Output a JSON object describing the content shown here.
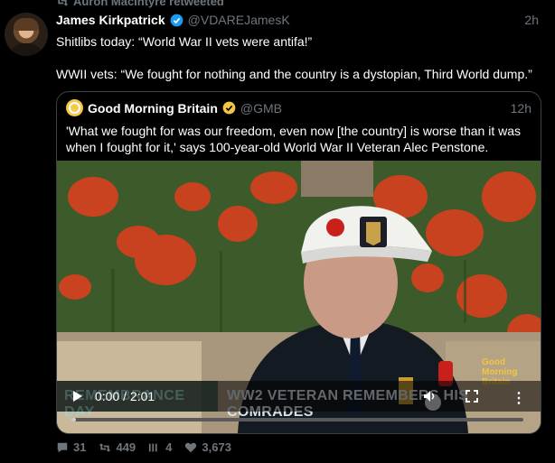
{
  "retweet": {
    "text": "Auron MacIntyre retweeted"
  },
  "tweet": {
    "author_name": "James Kirkpatrick",
    "handle": "@VDAREJamesK",
    "time": "2h",
    "lines": [
      "Shitlibs today: “World War II vets were antifa!”",
      "WWII vets: “We fought for nothing and the country is a dystopian, Third World dump.”"
    ]
  },
  "quoted": {
    "author_name": "Good Morning Britain",
    "handle": "@GMB",
    "time": "12h",
    "text": "'What we fought for was our freedom, even now [the country] is worse than it was when I fought for it,' says 100-year-old World War II Veteran Alec Penstone.",
    "video": {
      "timecode": "0:00 / 2:01",
      "banner_left": "REMEMBRANCE DAY",
      "banner_right": "WW2 VETERAN REMEMBERS HIS COMRADES",
      "logo_text": [
        "Good",
        "Morning",
        "Britain"
      ],
      "progress": 0.01
    }
  },
  "actions": {
    "replies": "31",
    "retweets": "449",
    "quotes": "4",
    "likes": "3,673"
  },
  "colors": {
    "background": "#000000",
    "muted": "#6e767d",
    "verified": "#1d9bf0",
    "gmb_verified": "#f4c543"
  }
}
